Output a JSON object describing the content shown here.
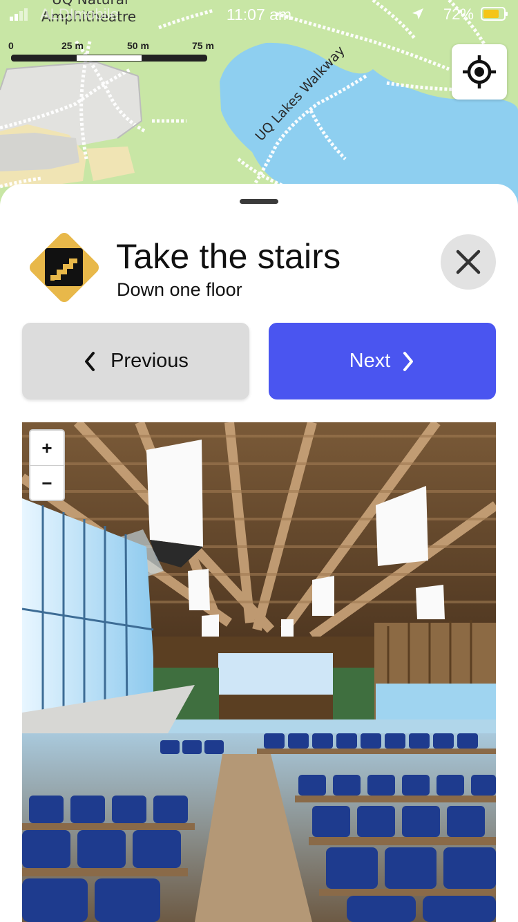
{
  "status_bar": {
    "carrier": "ALDImobile",
    "time": "11:07 am",
    "battery": "72%"
  },
  "map": {
    "labels": [
      "UQ Natural",
      "Amphitheatre",
      "UQ Lakes Walkway"
    ],
    "scale": {
      "ticks": [
        "0",
        "25 m",
        "50 m",
        "75 m"
      ]
    },
    "locate_icon": "crosshair-icon"
  },
  "instruction": {
    "icon": "stairs-icon",
    "icon_color": "#e8b84a",
    "title": "Take the stairs",
    "subtitle": "Down one floor"
  },
  "buttons": {
    "previous": "Previous",
    "next": "Next",
    "next_color": "#4a55f0",
    "close_icon": "close-icon"
  },
  "panorama": {
    "zoom_in": "+",
    "zoom_out": "−"
  }
}
